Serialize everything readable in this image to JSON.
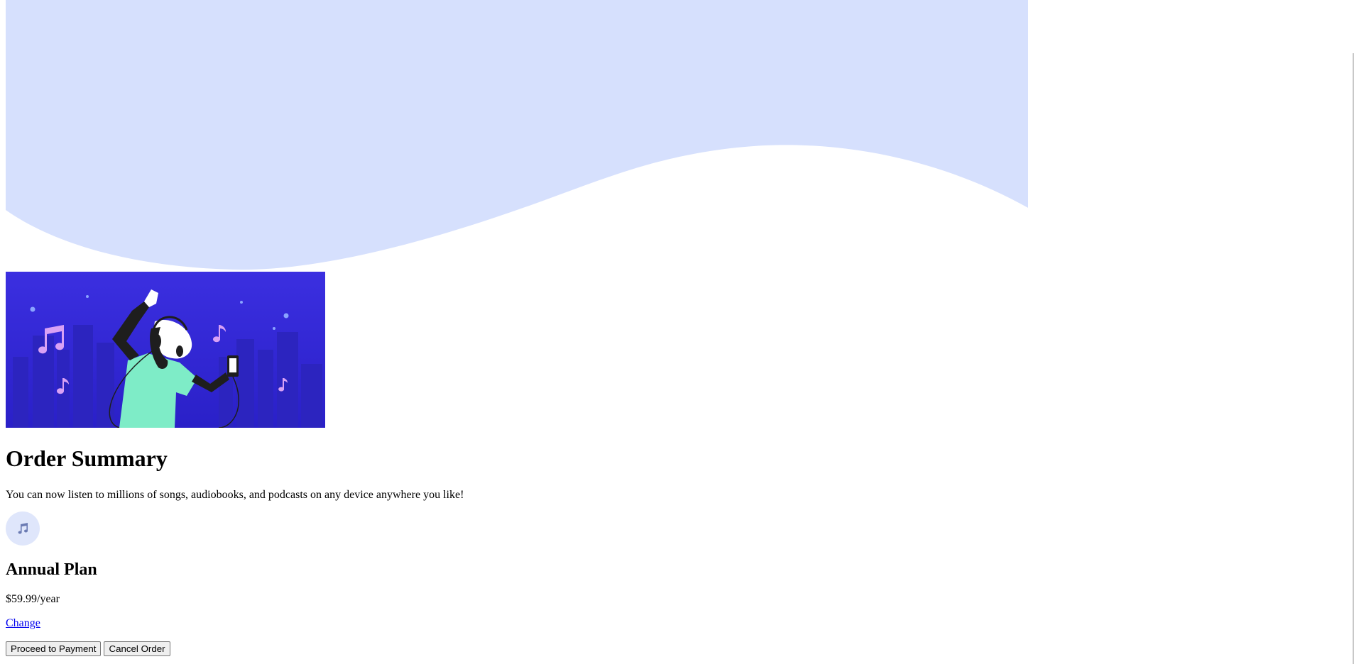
{
  "colors": {
    "wave": "#d6e0fd",
    "hero_bg": "#3b2fe0",
    "hero_city": "#2a22b8",
    "icon_circle": "#dfe6fb",
    "link": "#0000ee"
  },
  "hero": {
    "icon": "person-with-headphones-illustration"
  },
  "order": {
    "title": "Order Summary",
    "description": "You can now listen to millions of songs, audiobooks, and podcasts on any device anywhere you like!",
    "plan_icon": "music-note-icon",
    "plan_name": "Annual Plan",
    "plan_price": "$59.99/year",
    "change_label": "Change",
    "proceed_label": "Proceed to Payment",
    "cancel_label": "Cancel Order"
  }
}
